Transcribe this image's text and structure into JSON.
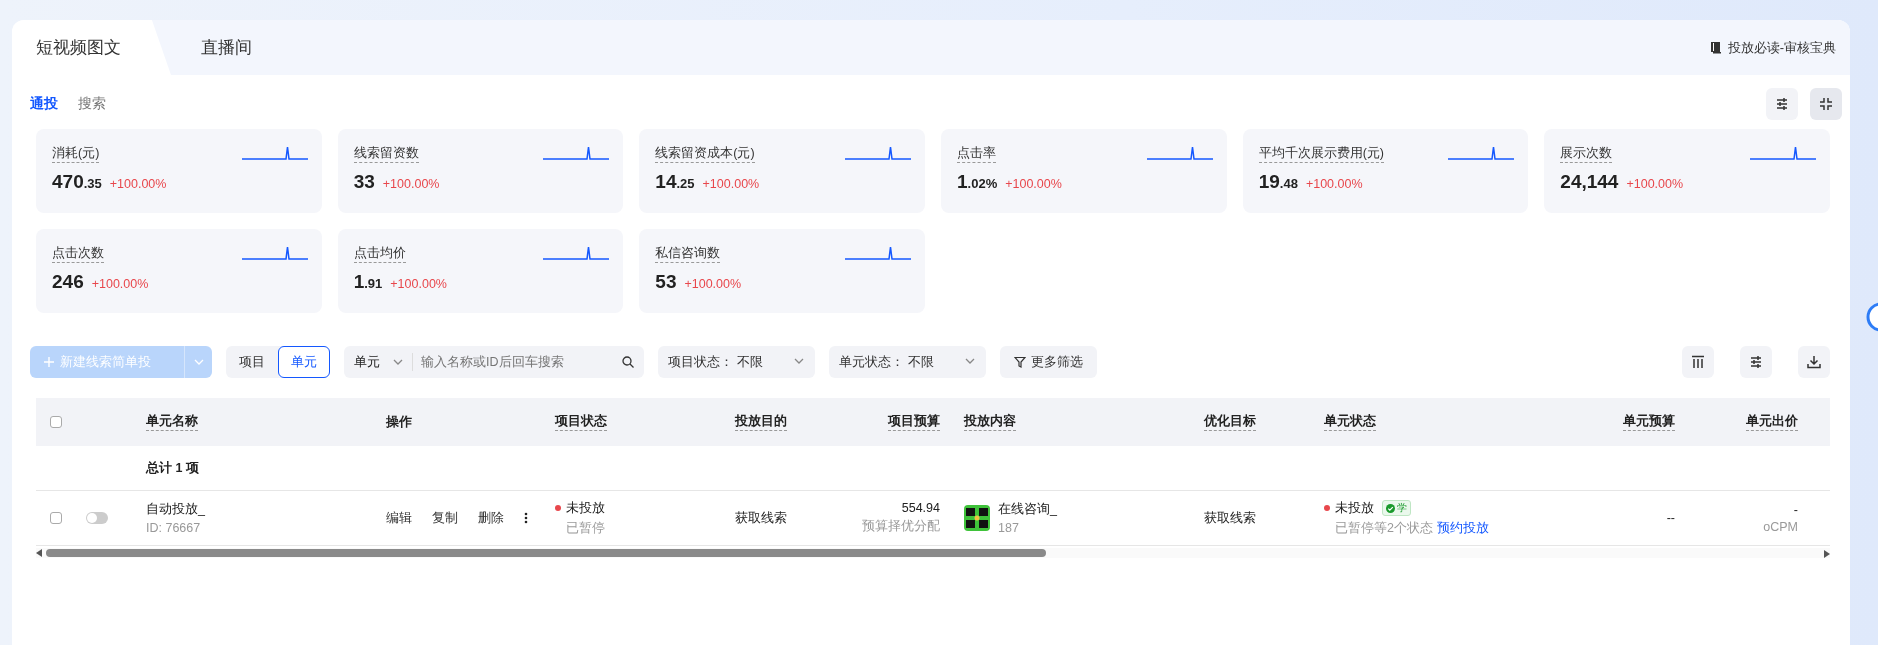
{
  "tabs": [
    {
      "label": "短视频图文",
      "selected": true
    },
    {
      "label": "直播间",
      "selected": false
    }
  ],
  "guide_link": "投放必读-审核宝典",
  "sub_tabs": [
    {
      "label": "通投",
      "selected": true
    },
    {
      "label": "搜索",
      "selected": false
    }
  ],
  "metrics": [
    {
      "label": "消耗(元)",
      "value": "470",
      "value_small": ".35",
      "change": "+100.00%"
    },
    {
      "label": "线索留资数",
      "value": "33",
      "change": "+100.00%"
    },
    {
      "label": "线索留资成本(元)",
      "value": "14",
      "value_small": ".25",
      "change": "+100.00%"
    },
    {
      "label": "点击率",
      "value": "1",
      "value_small": ".02%",
      "change": "+100.00%"
    },
    {
      "label": "平均千次展示费用(元)",
      "value": "19",
      "value_small": ".48",
      "change": "+100.00%"
    },
    {
      "label": "展示次数",
      "value": "24,144",
      "change": "+100.00%"
    },
    {
      "label": "点击次数",
      "value": "246",
      "change": "+100.00%"
    },
    {
      "label": "点击均价",
      "value": "1",
      "value_small": ".91",
      "change": "+100.00%"
    },
    {
      "label": "私信咨询数",
      "value": "53",
      "change": "+100.00%"
    }
  ],
  "toolbar": {
    "new_button": {
      "label": "新建线索简单投",
      "disabled": true
    },
    "levels": [
      {
        "label": "项目",
        "selected": false
      },
      {
        "label": "单元",
        "selected": true
      }
    ],
    "search": {
      "scope": "单元",
      "placeholder": "输入名称或ID后回车搜索"
    },
    "filters": [
      {
        "label": "项目状态：",
        "value": "不限"
      },
      {
        "label": "单元状态：",
        "value": "不限"
      }
    ],
    "more_filters": "更多筛选"
  },
  "table": {
    "columns": [
      {
        "label": "单元名称"
      },
      {
        "label": "操作"
      },
      {
        "label": "项目状态"
      },
      {
        "label": "投放目的"
      },
      {
        "label": "项目预算"
      },
      {
        "label": "投放内容"
      },
      {
        "label": "优化目标"
      },
      {
        "label": "单元状态"
      },
      {
        "label": "单元预算"
      },
      {
        "label": "单元出价"
      }
    ],
    "all_checked": false,
    "summary": "总计 1 项",
    "rows": [
      {
        "checked": false,
        "on": false,
        "name": "自动投放_",
        "id": "ID: 76667",
        "actions": [
          "编辑",
          "复制",
          "删除"
        ],
        "project_status": "未投放",
        "project_status_note": "已暂停",
        "purpose": "获取线索",
        "budget": "554.94",
        "budget_note": "预算择优分配",
        "content": {
          "kind": "picture",
          "title": "在线咨询_",
          "sub": "187"
        },
        "goal": "获取线索",
        "unit_status": "未投放",
        "unit_badge": "学",
        "unit_status_note": "已暂停等2个状态",
        "unit_status_link": "预约投放",
        "unit_budget": "--",
        "unit_price": "-",
        "bid_type": "oCPM"
      }
    ]
  }
}
